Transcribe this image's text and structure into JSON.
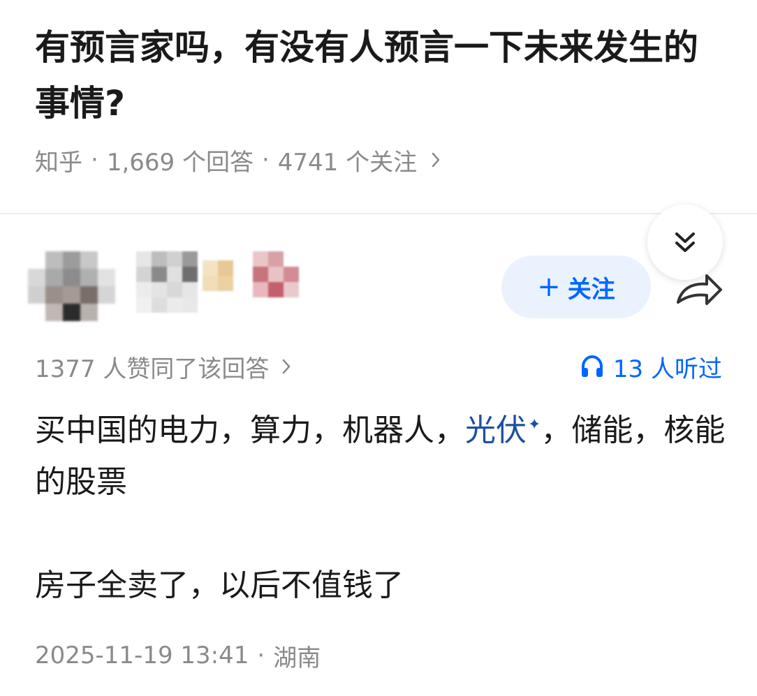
{
  "question": {
    "title": "有预言家吗，有没有人预言一下未来发生的事情?"
  },
  "meta": {
    "source": "知乎",
    "answers": "1,669 个回答",
    "followers": "4741 个关注",
    "separator": "·"
  },
  "follow": {
    "label": "关注",
    "plus": "+"
  },
  "answer": {
    "votes": "1377 人赞同了该回答",
    "listened": "13 人听过",
    "para1_before": "买中国的电力，算力，机器人，",
    "para1_keyword": "光伏",
    "para1_keyword_mark": "✦",
    "para1_after": "，储能，核能的股票",
    "para2": "房子全卖了，以后不值钱了",
    "timestamp": "2025-11-19 13:41",
    "location": "湖南",
    "separator": "·"
  },
  "colors": {
    "accent": "#0066ff",
    "keyword": "#1d4fa1",
    "muted": "#8a8a8a",
    "follow_bg": "#eaf2fe"
  },
  "icons": {
    "collapse": "double-chevron-down-icon",
    "share": "share-arrow-icon",
    "listen": "headphones-icon",
    "chevron": "chevron-right-icon"
  }
}
